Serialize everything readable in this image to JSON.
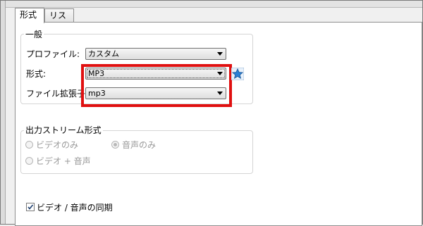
{
  "tabs": [
    {
      "label": "形式",
      "active": true
    },
    {
      "label": "リスト",
      "active": false
    }
  ],
  "general": {
    "title": "一般",
    "profile_label": "プロファイル:",
    "profile_value": "カスタム",
    "format_label": "形式:",
    "format_value": "MP3",
    "extension_label": "ファイル拡張子:",
    "extension_value": "mp3"
  },
  "stream": {
    "title": "出力ストリーム形式",
    "options": [
      {
        "label": "ビデオのみ",
        "checked": false,
        "enabled": false
      },
      {
        "label": "音声のみ",
        "checked": true,
        "enabled": false
      },
      {
        "label": "ビデオ + 音声",
        "checked": false,
        "enabled": false
      }
    ]
  },
  "sync": {
    "label": "ビデオ / 音声の同期",
    "checked": true
  },
  "colors": {
    "highlight": "#e01010",
    "star": "#2a7fd4"
  }
}
